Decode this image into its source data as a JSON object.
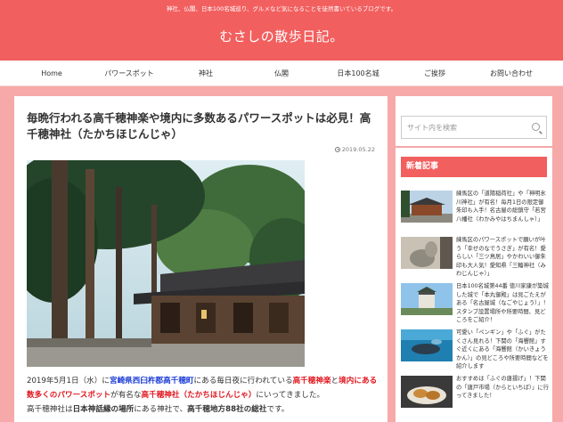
{
  "header": {
    "tagline": "神社、仏閣、日本100名城巡り、グルメなど気になることを徒然書いているブログです。",
    "site_title": "むさしの散歩日記。"
  },
  "nav": {
    "items": [
      "Home",
      "パワースポット",
      "神社",
      "仏閣",
      "日本100名城",
      "ご挨拶",
      "お問い合わせ"
    ]
  },
  "post": {
    "title": "毎晩行われる高千穂神楽や境内に多数あるパワースポットは必見！高千穂神社（たかちほじんじゃ）",
    "date": "2019.05.22",
    "body": {
      "p1_a": "2019年5月1日（水）に",
      "p1_b": "宮崎県西臼杵郡高千穂町",
      "p1_c": "にある毎日夜に行われている",
      "p1_d": "高千穂神楽",
      "p1_e": "と",
      "p1_f": "境内にある数多くのパワースポット",
      "p1_g": "が有名な",
      "p1_h": "高千穂神社（たかちほじんじゃ）",
      "p1_i": "にいってきました。",
      "p2_a": "高千穂神社は",
      "p2_b": "日本神話縁の場所",
      "p2_c": "にある神社で、",
      "p2_d": "高千穂地方88社の総社",
      "p2_e": "です。"
    }
  },
  "sidebar": {
    "search_placeholder": "サイト内を検索",
    "recent_heading": "新着記事",
    "recent": [
      "練馬区の「道陽稲荷社」や「神明氷川神社」が有名！毎月1日の限定御朱印も入手！名古屋の総鎮守「若宮八幡社（わかみやはちまんしゃ）」",
      "練馬区のパワースポットで願いが叶う「幸せのなでうさぎ」が有名！愛らしい「三ツ鳥居」やかわいい御朱印も大人気！愛知県「三輪神社（みわじんじゃ）」",
      "日本100名城第44番 徳川家康が築城した城で「本丸御殿」は見ごたえがある「名古屋城（なごやじょう）」！スタンプ設置場所や所要時間、見どころをご紹介！",
      "可愛い「ペンギン」や「ふぐ」がたくさん見れる！下関の「海響館」すぐ近くにある「海響館（かいきょうかん）」の見どころや所要時間などを紹介します",
      "おすすめは「ふぐの唐揚げ」！下関の「唐戸市場（からといちば）」に行ってきました！"
    ]
  }
}
